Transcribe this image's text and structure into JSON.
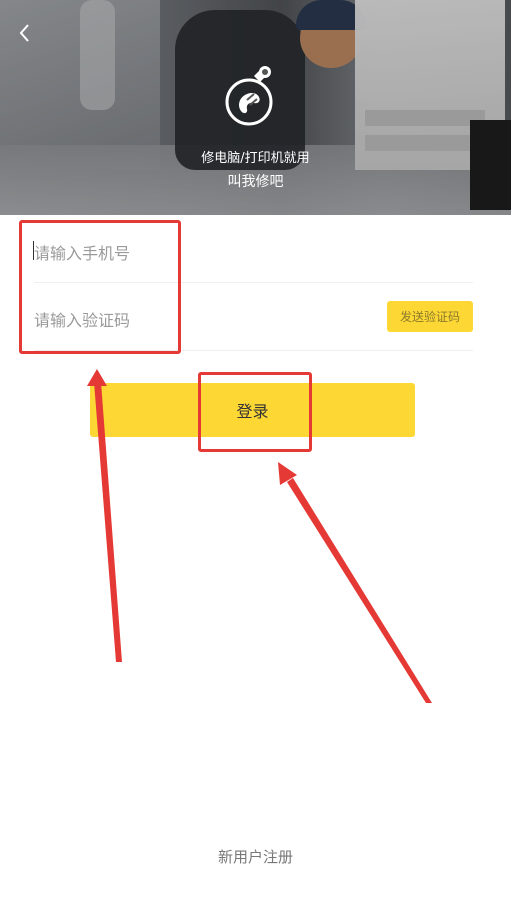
{
  "header": {
    "back_icon": "chevron-left-icon",
    "logo_icon": "wrench-hand-icon",
    "slogan_line1": "修电脑/打印机就用",
    "slogan_line2": "叫我修吧"
  },
  "form": {
    "phone_placeholder": "请输入手机号",
    "code_placeholder": "请输入验证码",
    "send_code_label": "发送验证码",
    "login_label": "登录"
  },
  "footer": {
    "register_label": "新用户注册"
  },
  "colors": {
    "accent": "#fdd835",
    "annotation_red": "#e53935",
    "placeholder_text": "#9a9a9a",
    "register_text": "#777777"
  }
}
